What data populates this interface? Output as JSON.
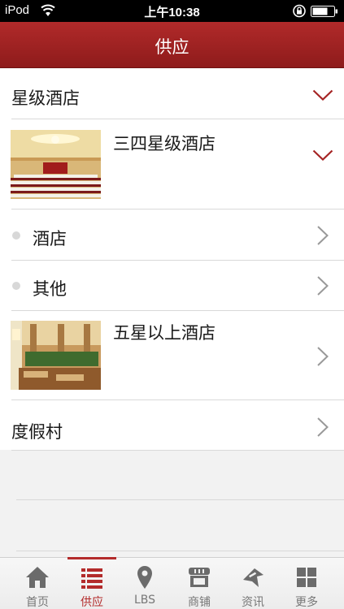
{
  "status_bar": {
    "carrier": "iPod",
    "time": "上午10:38"
  },
  "header": {
    "title": "供应"
  },
  "list": {
    "category_1": {
      "label": "星级酒店"
    },
    "group_1": {
      "label": "三四星级酒店"
    },
    "item_1": {
      "label": "酒店"
    },
    "item_2": {
      "label": "其他"
    },
    "group_2": {
      "label": "五星以上酒店"
    },
    "category_2": {
      "label": "度假村"
    }
  },
  "tabs": [
    {
      "label": "首页",
      "icon": "home-icon"
    },
    {
      "label": "供应",
      "icon": "list-icon",
      "active": true
    },
    {
      "label": "LBS",
      "icon": "location-pin-icon"
    },
    {
      "label": "商铺",
      "icon": "store-icon"
    },
    {
      "label": "资讯",
      "icon": "news-icon"
    },
    {
      "label": "更多",
      "icon": "grid-icon"
    }
  ],
  "colors": {
    "brand": "#a52424",
    "chevron_accent": "#a52424",
    "chevron_gray": "#999999"
  }
}
